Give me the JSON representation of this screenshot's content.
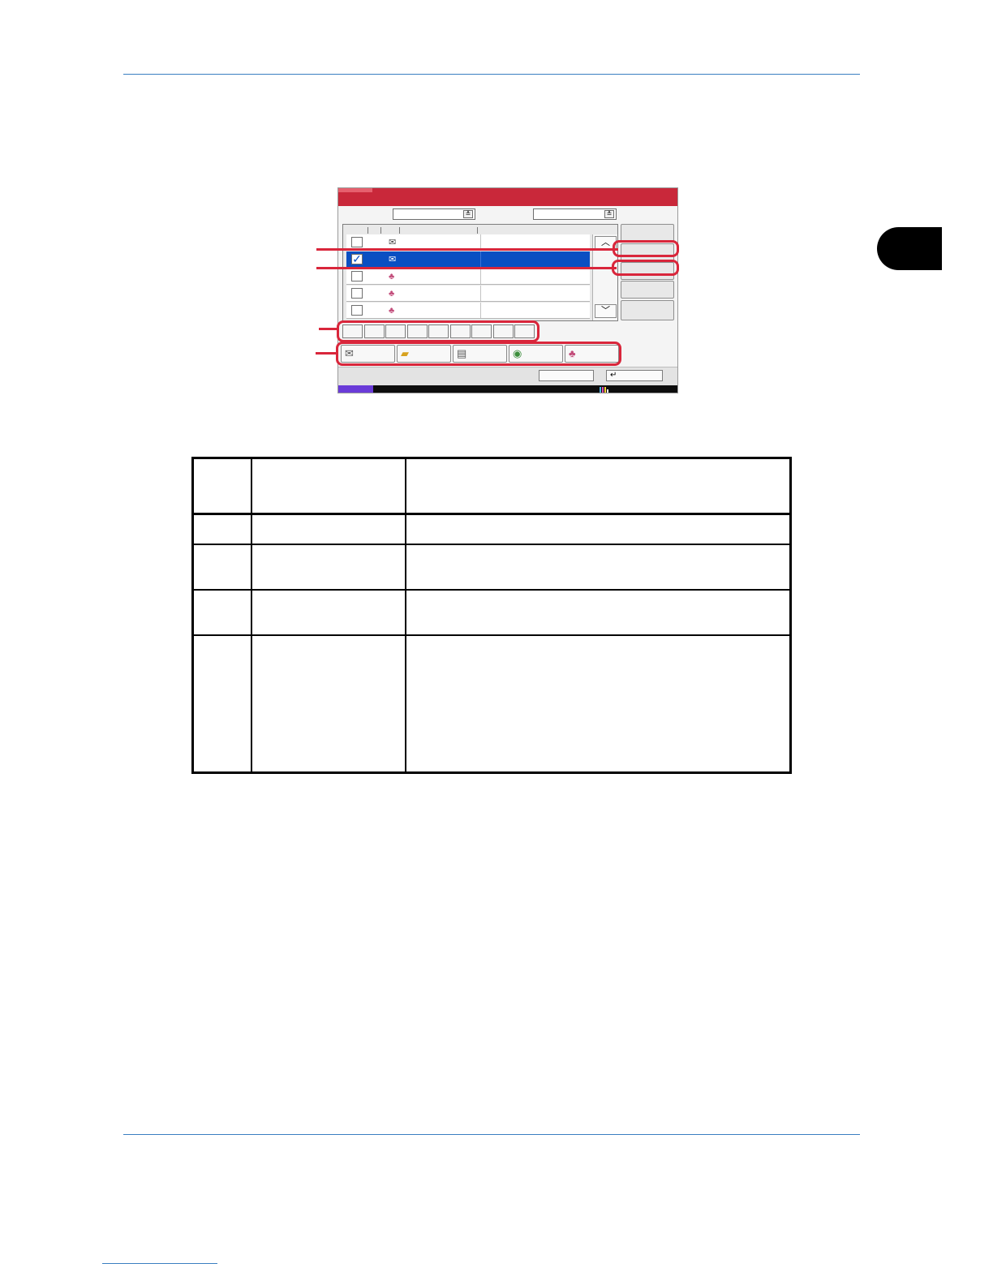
{
  "page": {
    "accent_color": "#3a7fc1",
    "callout_color": "#d9263b",
    "title_bar_color": "#c9283a",
    "selection_color": "#0a4fc2"
  },
  "panel": {
    "list_rows": [
      {
        "icon": "mail-icon",
        "checked": false,
        "selected": false
      },
      {
        "icon": "mail-icon",
        "checked": true,
        "selected": true
      },
      {
        "icon": "group-icon",
        "checked": false,
        "selected": false
      },
      {
        "icon": "group-icon",
        "checked": false,
        "selected": false
      },
      {
        "icon": "group-icon",
        "checked": false,
        "selected": false
      }
    ],
    "check_mark": "✓",
    "scroll_up": "︿",
    "scroll_down": "﹀",
    "dropdown_arrow": "≚",
    "alpha_key_count": 9,
    "type_buttons": [
      "mail-icon",
      "folder-icon",
      "fax-icon",
      "ifax-icon",
      "group-icon"
    ],
    "enter_glyph": "↵"
  }
}
